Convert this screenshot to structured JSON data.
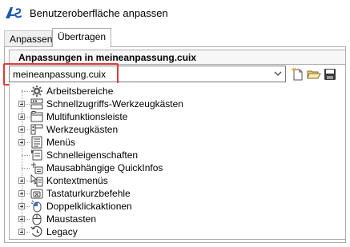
{
  "window": {
    "title": "Benutzeroberfläche anpassen",
    "accent": "#e03a3a"
  },
  "tabs": [
    {
      "label": "Anpassen",
      "active": false
    },
    {
      "label": "Übertragen",
      "active": true
    }
  ],
  "panel": {
    "header": "Anpassungen in meineanpassung.cuix",
    "file_combo": {
      "value": "meineanpassung.cuix"
    },
    "toolbar": {
      "new_icon": "new-file-icon",
      "open_icon": "open-folder-icon",
      "save_icon": "save-icon"
    }
  },
  "tree": {
    "items": [
      {
        "label": "Arbeitsbereiche",
        "icon": "gear-icon",
        "expandable": false
      },
      {
        "label": "Schnellzugriffs-Werkzeugkästen",
        "icon": "quick-access-toolbar-icon",
        "expandable": true
      },
      {
        "label": "Multifunktionsleiste",
        "icon": "ribbon-icon",
        "expandable": true
      },
      {
        "label": "Werkzeugkästen",
        "icon": "toolbars-icon",
        "expandable": true
      },
      {
        "label": "Menüs",
        "icon": "menus-icon",
        "expandable": true
      },
      {
        "label": "Schnelleigenschaften",
        "icon": "quick-properties-icon",
        "expandable": false
      },
      {
        "label": "Mausabhängige QuickInfos",
        "icon": "rollover-tooltip-icon",
        "expandable": false
      },
      {
        "label": "Kontextmenüs",
        "icon": "context-menu-icon",
        "expandable": true
      },
      {
        "label": "Tastaturkurzbefehle",
        "icon": "keyboard-shortcut-icon",
        "expandable": true
      },
      {
        "label": "Doppelklickaktionen",
        "icon": "double-click-icon",
        "expandable": true
      },
      {
        "label": "Maustasten",
        "icon": "mouse-buttons-icon",
        "expandable": true
      },
      {
        "label": "Legacy",
        "icon": "legacy-clock-icon",
        "expandable": true
      }
    ]
  }
}
